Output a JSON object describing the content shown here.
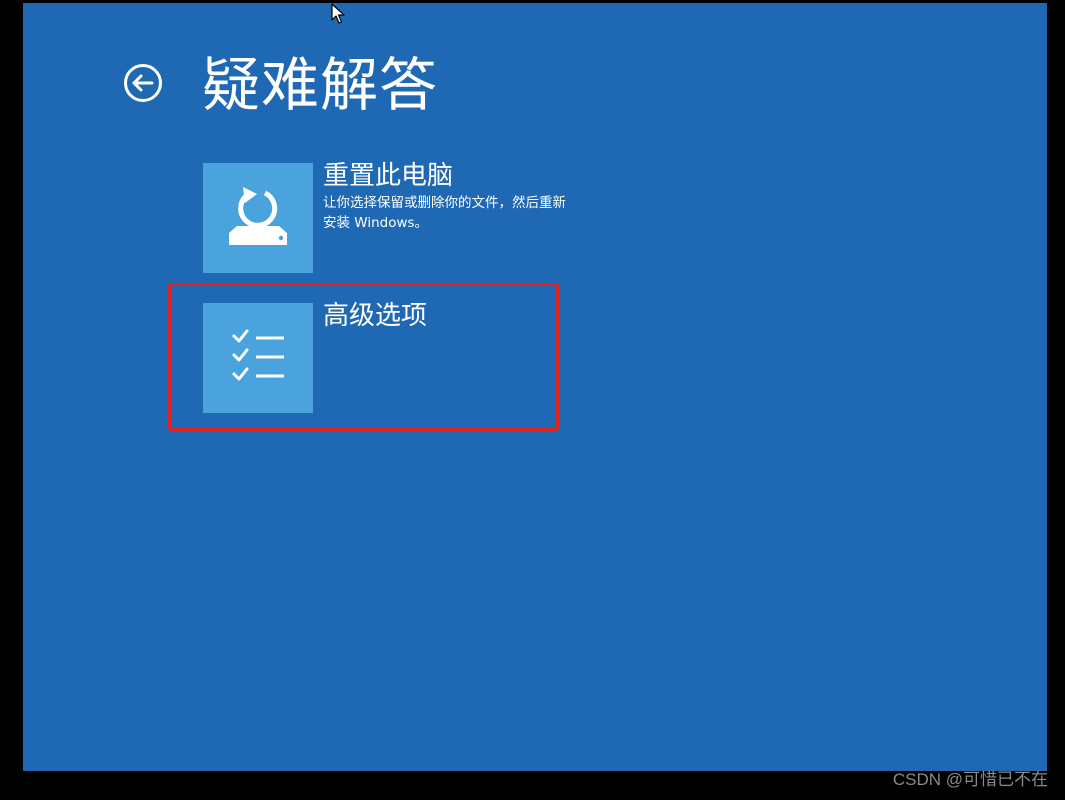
{
  "header": {
    "title": "疑难解答",
    "back_icon": "back-arrow-circle-icon"
  },
  "options": [
    {
      "title": "重置此电脑",
      "description": "让你选择保留或删除你的文件，然后重新安装 Windows。",
      "icon": "reset-pc-icon"
    },
    {
      "title": "高级选项",
      "description": "",
      "icon": "checklist-icon"
    }
  ],
  "annotation": {
    "highlight_color": "#e0231f",
    "highlighted_option": "高级选项"
  },
  "colors": {
    "background": "#1f68b4",
    "tile": "#4ba3dd",
    "text": "#ffffff",
    "outer_frame": "#000000"
  },
  "watermark": {
    "text": "CSDN @可惜已不在"
  }
}
